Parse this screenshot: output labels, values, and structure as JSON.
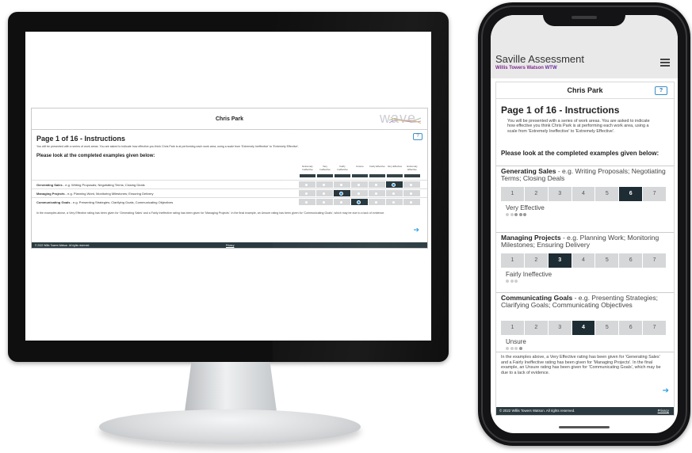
{
  "desktop": {
    "candidate_name": "Chris Park",
    "logo_text": "wave",
    "page_title": "Page 1 of 16 - Instructions",
    "help_label": "?",
    "intro": "You will be presented with a series of work areas. You are asked to indicate how effective you think Chris Park is at performing each work area, using a scale from 'Extremely Ineffective' to 'Extremely Effective'.",
    "examples_heading": "Please look at the completed examples given below:",
    "columns": [
      "Extremely Ineffective",
      "Very Ineffective",
      "Fairly Ineffective",
      "Unsure",
      "Fairly Effective",
      "Very Effective",
      "Extremely Effective"
    ],
    "rows": [
      {
        "title": "Generating Sales",
        "desc": " - e.g. Writing Proposals; Negotiating Terms; Closing Deals",
        "selected": 6
      },
      {
        "title": "Managing Projects",
        "desc": " - e.g. Planning Work; Monitoring Milestones; Ensuring Delivery",
        "selected": 3
      },
      {
        "title": "Communicating Goals",
        "desc": " - e.g. Presenting Strategies; Clarifying Goals; Communicating Objectives",
        "selected": 4
      }
    ],
    "note": "In the examples above, a Very Effective rating has been given for 'Generating Sales' and a Fairly Ineffective rating has been given for 'Managing Projects'. In the final example, an Unsure rating has been given for 'Communicating Goals', which may be due to a lack of evidence.",
    "next_icon": "arrow-right-icon",
    "footer_copy": "© 2022 Willis Towers Watson. All rights reserved.",
    "footer_privacy": "Privacy"
  },
  "mobile": {
    "brand": "Saville Assessment",
    "brand_sub": "Willis Towers Watson",
    "brand_sub_logo": "WTW",
    "menu_icon": "hamburger-menu-icon",
    "candidate_name": "Chris Park",
    "help_label": "?",
    "page_title": "Page 1 of 16 - Instructions",
    "intro": "You will be presented with a series of work areas. You are asked to indicate how effective you think Chris Park is at performing each work area, using a scale from 'Extremely Ineffective' to 'Extremely Effective'.",
    "examples_heading": "Please look at the completed examples given below:",
    "scale": [
      "1",
      "2",
      "3",
      "4",
      "5",
      "6",
      "7"
    ],
    "items": [
      {
        "title": "Generating Sales",
        "desc": " - e.g. Writing Proposals; Negotiating Terms; Closing Deals",
        "selected": 6,
        "rating": "Very Effective",
        "dots": 5,
        "dots_on": 3
      },
      {
        "title": "Managing Projects",
        "desc": " - e.g. Planning Work; Monitoring Milestones; Ensuring Delivery",
        "selected": 3,
        "rating": "Fairly Ineffective",
        "dots": 3,
        "dots_on": 0
      },
      {
        "title": "Communicating Goals",
        "desc": " - e.g. Presenting Strategies; Clarifying Goals; Communicating Objectives",
        "selected": 4,
        "rating": "Unsure",
        "dots": 4,
        "dots_on": 1
      }
    ],
    "note": "In the examples above, a Very Effective rating has been given for 'Generating Sales' and a Fairly Ineffective rating has been given for 'Managing Projects'. In the final example, an Unsure rating has been given for 'Communicating Goals', which may be due to a lack of evidence.",
    "next_icon": "arrow-right-icon",
    "footer_copy": "© 2022 Willis Towers Watson. All rights reserved.",
    "footer_privacy": "Privacy"
  },
  "colors": {
    "accent_blue": "#2aa0e0",
    "selected_dark": "#1f3037",
    "footer_dark": "#2b3a40",
    "brand_purple": "#7d2a8d"
  }
}
